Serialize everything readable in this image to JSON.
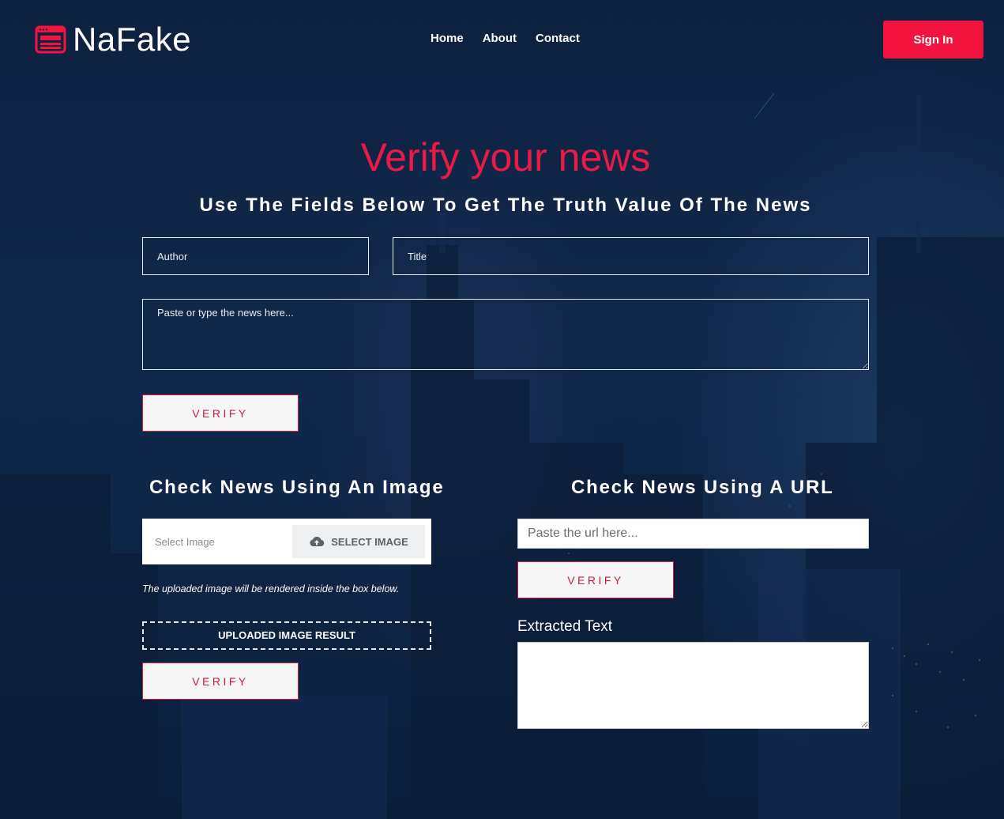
{
  "header": {
    "brand": "NaFake",
    "nav": [
      "Home",
      "About",
      "Contact"
    ],
    "signin_label": "Sign In"
  },
  "hero": {
    "title": "Verify your news",
    "subtitle": "Use The Fields Below To Get The Truth Value Of The News"
  },
  "form": {
    "author_placeholder": "Author",
    "title_placeholder": "Title",
    "news_placeholder": "Paste or type the news here...",
    "verify_label": "VERIFY"
  },
  "image_section": {
    "title": "Check News Using An Image",
    "file_label": "Select Image",
    "select_button": "SELECT IMAGE",
    "note": "The uploaded image will be rendered inside the box below.",
    "result_label": "UPLOADED IMAGE RESULT",
    "verify_label": "VERIFY"
  },
  "url_section": {
    "title": "Check News Using A URL",
    "url_placeholder": "Paste the url here...",
    "verify_label": "VERIFY",
    "extracted_label": "Extracted Text"
  },
  "colors": {
    "accent": "#f2133f",
    "accent_text": "#ea1a46",
    "background": "#0f2748"
  },
  "icons": {
    "logo": "browser-window-icon",
    "upload": "cloud-upload-icon"
  }
}
